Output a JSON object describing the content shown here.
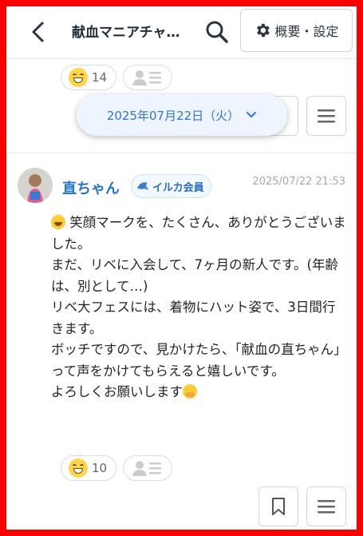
{
  "header": {
    "back_icon": "chevron-left-icon",
    "title": "献血マニアチャ…",
    "search_icon": "search-icon",
    "settings_icon": "gear-icon",
    "settings_label": "概要・設定"
  },
  "previous_post": {
    "reaction_icon": "grinning-face-icon",
    "reaction_count": "14",
    "readers_icon": "readers-icon",
    "bookmark_icon": "bookmark-icon",
    "menu_icon": "hamburger-menu-icon"
  },
  "date_pill": {
    "label": "2025年07月22日（火）",
    "chevron_icon": "chevron-down-icon",
    "accent": "#2f74d8"
  },
  "post": {
    "author": "直ちゃん",
    "badge_icon": "dolphin-icon",
    "badge_label": "イルカ会員",
    "timestamp": "2025/07/22 21:53",
    "lines": [
      "笑顔マークを、たくさん、ありがとうございました。",
      "まだ、リベに入会して、7ヶ月の新人です。(年齢は、別として…)",
      "リベ大フェスには、着物にハット姿で、3日間行きます。",
      "ボッチですので、見かけたら、「献血の直ちゃん」って声をかけてもらえると嬉しいです。",
      "よろしくお願いします"
    ],
    "reaction_icon": "grinning-face-icon",
    "reaction_count": "10",
    "readers_icon": "readers-icon",
    "bookmark_icon": "bookmark-icon",
    "menu_icon": "hamburger-menu-icon",
    "username_color": "#2474d2"
  },
  "frame_color": "#ff0000"
}
